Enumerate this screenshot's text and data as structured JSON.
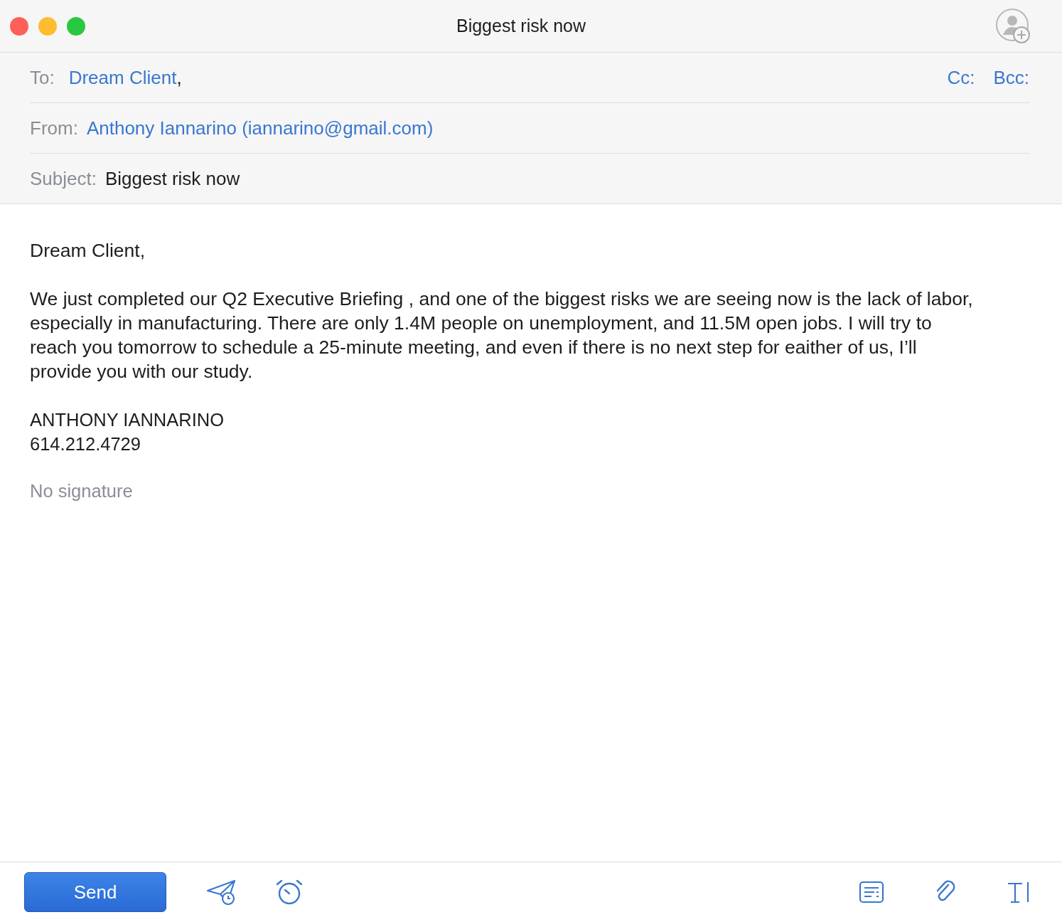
{
  "window": {
    "title": "Biggest risk now"
  },
  "header": {
    "to": {
      "label": "To:",
      "recipients": [
        {
          "name": "Dream Client",
          "separator": ","
        }
      ]
    },
    "cc": "Cc:",
    "bcc": "Bcc:",
    "from": {
      "label": "From:",
      "value": "Anthony Iannarino (iannarino@gmail.com)"
    },
    "subject": {
      "label": "Subject:",
      "value": "Biggest risk now"
    }
  },
  "body": {
    "greeting": "Dream Client,",
    "paragraph": "We just completed our Q2 Executive Briefing , and one of the biggest risks we are seeing now is the lack of labor, especially in manufacturing. There are only 1.4M people on unemployment, and 11.5M open jobs. I will try to reach you tomorrow to schedule a 25-minute meeting, and even if there is no next step for eaither of us, I’ll provide you with our study.",
    "signature_lines": [
      "ANTHONY IANNARINO",
      "614.212.4729"
    ],
    "signature_placeholder": "No signature"
  },
  "toolbar": {
    "send": "Send"
  }
}
